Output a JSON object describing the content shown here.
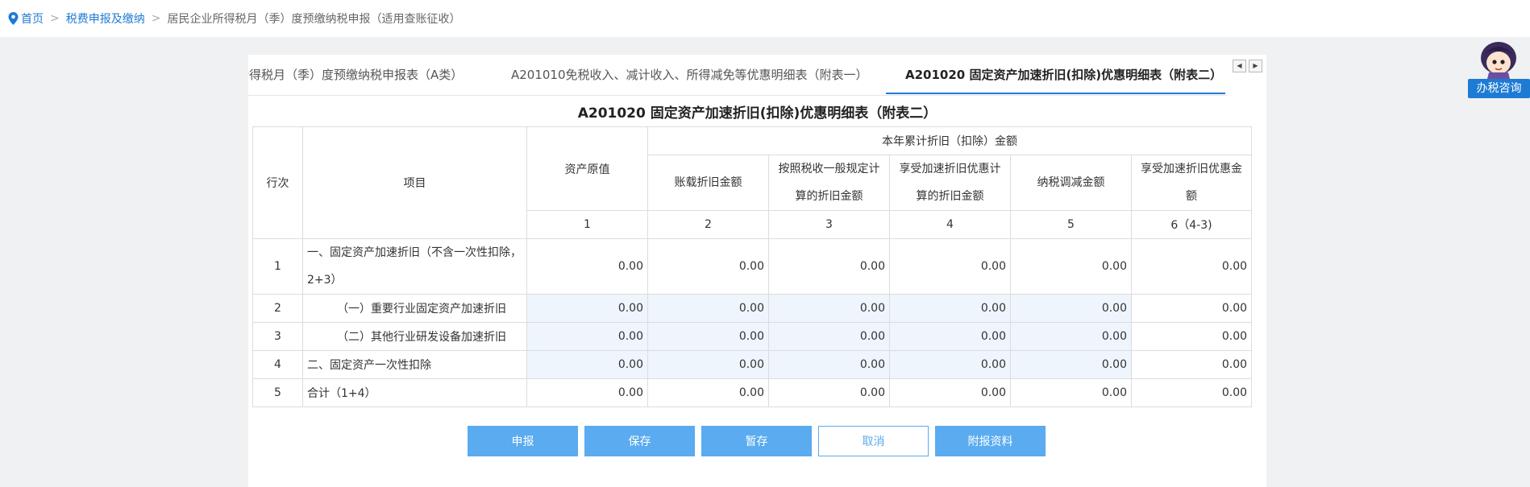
{
  "breadcrumb": {
    "home": "首页",
    "level2": "税费申报及缴纳",
    "current": "居民企业所得税月（季）度预缴纳税申报（适用查账征收）",
    "separator": ">"
  },
  "tabs": [
    {
      "label": "所得税月（季）度预缴纳税申报表（A类）",
      "active": false
    },
    {
      "label": "A201010免税收入、减计收入、所得减免等优惠明细表（附表一）",
      "active": false
    },
    {
      "label": "A201020 固定资产加速折旧(扣除)优惠明细表（附表二）",
      "active": true
    }
  ],
  "tab_arrows": {
    "prev": "◀",
    "next": "▶"
  },
  "form": {
    "title": "A201020 固定资产加速折旧(扣除)优惠明细表（附表二）",
    "headers": {
      "row_no": "行次",
      "item": "项目",
      "original_value": "资产原值",
      "group": "本年累计折旧（扣除）金额",
      "col2": "账载折旧金额",
      "col3": "按照税收一般规定计算的折旧金额",
      "col4": "享受加速折旧优惠计算的折旧金额",
      "col5": "纳税调减金额",
      "col6": "享受加速折旧优惠金额"
    },
    "col_numbers": [
      "1",
      "2",
      "3",
      "4",
      "5",
      "6（4-3)"
    ],
    "rows": [
      {
        "no": "1",
        "item": "一、固定资产加速折旧（不含一次性扣除，2+3）",
        "values": [
          "0.00",
          "0.00",
          "0.00",
          "0.00",
          "0.00",
          "0.00"
        ]
      },
      {
        "no": "2",
        "item": "（一）重要行业固定资产加速折旧",
        "values": [
          "0.00",
          "0.00",
          "0.00",
          "0.00",
          "0.00",
          "0.00"
        ]
      },
      {
        "no": "3",
        "item": "（二）其他行业研发设备加速折旧",
        "values": [
          "0.00",
          "0.00",
          "0.00",
          "0.00",
          "0.00",
          "0.00"
        ]
      },
      {
        "no": "4",
        "item": "二、固定资产一次性扣除",
        "values": [
          "0.00",
          "0.00",
          "0.00",
          "0.00",
          "0.00",
          "0.00"
        ]
      },
      {
        "no": "5",
        "item": "合计（1+4）",
        "values": [
          "0.00",
          "0.00",
          "0.00",
          "0.00",
          "0.00",
          "0.00"
        ]
      }
    ]
  },
  "buttons": {
    "declare": "申报",
    "save": "保存",
    "temp_save": "暂存",
    "cancel": "取消",
    "attachments": "附报资料"
  },
  "assistant": {
    "label": "办税咨询"
  },
  "colors": {
    "accent": "#1e7bd4",
    "button": "#5aabef",
    "editable_bg": "#eef5fc"
  }
}
